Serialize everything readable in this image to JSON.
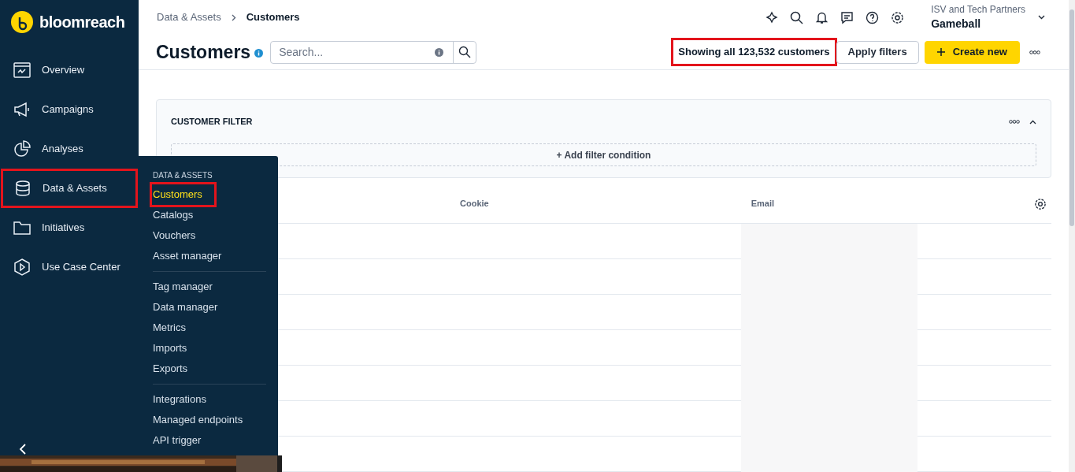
{
  "logo": {
    "text": "bloomreach"
  },
  "nav": [
    {
      "label": "Overview",
      "highlighted": false
    },
    {
      "label": "Campaigns",
      "highlighted": false
    },
    {
      "label": "Analyses",
      "highlighted": false
    },
    {
      "label": "Data & Assets",
      "highlighted": true
    },
    {
      "label": "Initiatives",
      "highlighted": false
    },
    {
      "label": "Use Case Center",
      "highlighted": false
    }
  ],
  "submenu": {
    "heading": "DATA & ASSETS",
    "groups": [
      [
        {
          "label": "Customers",
          "selected": true,
          "highlighted": true
        },
        {
          "label": "Catalogs",
          "selected": false,
          "highlighted": false
        },
        {
          "label": "Vouchers",
          "selected": false,
          "highlighted": false
        },
        {
          "label": "Asset manager",
          "selected": false,
          "highlighted": false
        }
      ],
      [
        {
          "label": "Tag manager",
          "selected": false,
          "highlighted": false
        },
        {
          "label": "Data manager",
          "selected": false,
          "highlighted": false
        },
        {
          "label": "Metrics",
          "selected": false,
          "highlighted": false
        },
        {
          "label": "Imports",
          "selected": false,
          "highlighted": false
        },
        {
          "label": "Exports",
          "selected": false,
          "highlighted": false
        }
      ],
      [
        {
          "label": "Integrations",
          "selected": false,
          "highlighted": false
        },
        {
          "label": "Managed endpoints",
          "selected": false,
          "highlighted": false
        },
        {
          "label": "API trigger",
          "selected": false,
          "highlighted": false
        }
      ]
    ]
  },
  "breadcrumb": [
    "Data & Assets",
    "Customers"
  ],
  "account": {
    "org": "ISV and Tech Partners",
    "project": "Gameball"
  },
  "page_title": "Customers",
  "search": {
    "placeholder": "Search..."
  },
  "count": {
    "text": "Showing all 123,532 customers",
    "highlighted": true
  },
  "buttons": {
    "apply": "Apply filters",
    "create": "Create new"
  },
  "filter": {
    "title": "CUSTOMER FILTER",
    "add": "+ Add filter condition"
  },
  "table": {
    "columns": [
      "Cookie",
      "Email"
    ],
    "rows": [
      {
        "kind": "loading"
      },
      {
        "kind": "loading"
      },
      {
        "kind": "loading"
      },
      {
        "kind": "loading"
      },
      {
        "kind": "loading"
      },
      {
        "kind": "loading"
      },
      {
        "kind": "loading"
      }
    ]
  }
}
